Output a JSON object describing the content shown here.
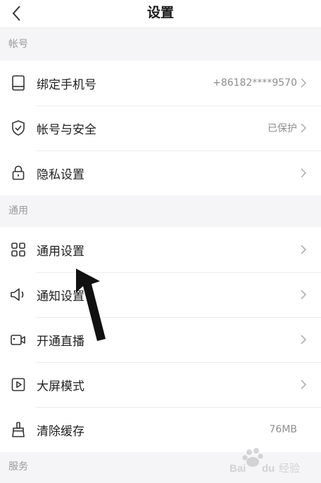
{
  "header": {
    "title": "设置",
    "back_icon": "chevron-left-icon"
  },
  "sections": {
    "account": {
      "title": "帐号"
    },
    "general": {
      "title": "通用"
    },
    "service": {
      "title": "服务"
    }
  },
  "account_items": [
    {
      "label": "绑定手机号",
      "value": "+86182****9570",
      "icon": "phone-icon"
    },
    {
      "label": "帐号与安全",
      "value": "已保护",
      "icon": "shield-check-icon"
    },
    {
      "label": "隐私设置",
      "value": "",
      "icon": "lock-icon"
    }
  ],
  "general_items": [
    {
      "label": "通用设置",
      "value": "",
      "icon": "grid-icon"
    },
    {
      "label": "通知设置",
      "value": "",
      "icon": "speaker-icon"
    },
    {
      "label": "开通直播",
      "value": "",
      "icon": "video-camera-icon"
    },
    {
      "label": "大屏模式",
      "value": "",
      "icon": "play-square-icon"
    },
    {
      "label": "清除缓存",
      "value": "76MB",
      "icon": "broom-icon"
    }
  ],
  "watermark": {
    "text": "Baidu 经验",
    "color": "#b7b7b7"
  },
  "colors": {
    "background": "#f5f5f7",
    "row_background": "#ffffff",
    "divider": "#ececec",
    "secondary_text": "#8e8e8e"
  }
}
